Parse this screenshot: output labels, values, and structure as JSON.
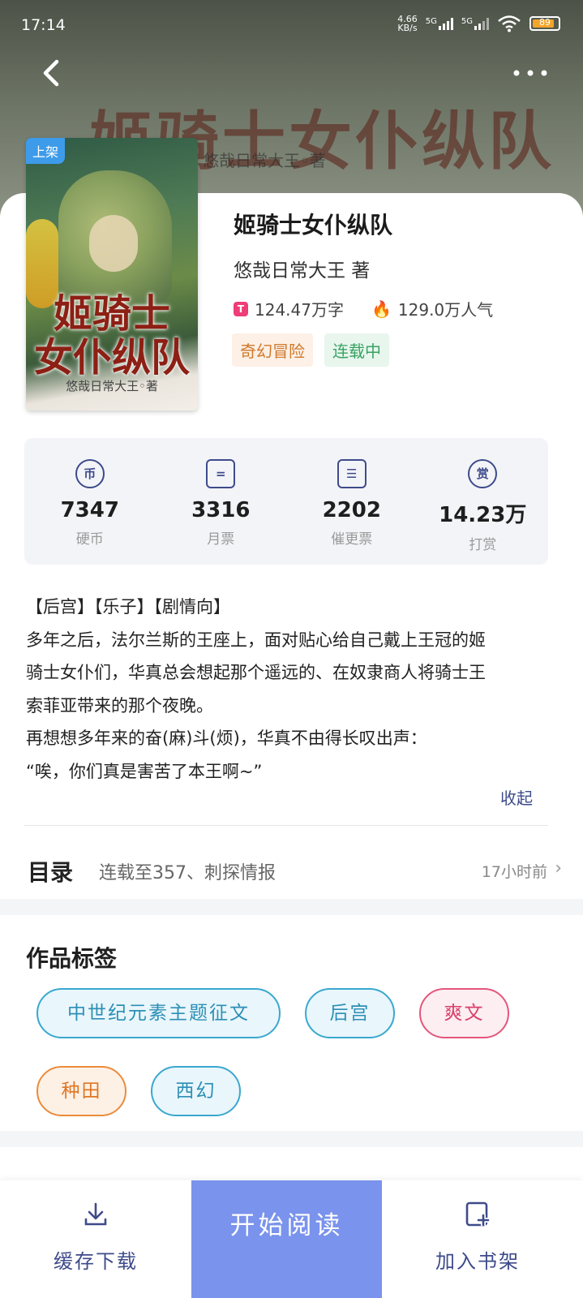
{
  "status_bar": {
    "time": "17:14",
    "net_speed_value": "4.66",
    "net_speed_unit": "KB/s",
    "signal1": "5G",
    "signal2": "5G",
    "battery": "89"
  },
  "hero": {
    "blurred_title": "姬骑士女仆纵队",
    "blurred_author": "悠哉日常大王◦著"
  },
  "book": {
    "cover_badge": "上架",
    "cover_title_line1": "姬骑士",
    "cover_title_line2": "女仆纵队",
    "cover_author": "悠哉日常大王◦著",
    "title": "姬骑士女仆纵队",
    "author": "悠哉日常大王 著",
    "word_icon": "T",
    "word_count": "124.47万字",
    "popularity": "129.0万人气",
    "genre": "奇幻冒险",
    "status": "连载中"
  },
  "stats": [
    {
      "icon": "coin-icon",
      "glyph": "币",
      "value": "7347",
      "label": "硬币"
    },
    {
      "icon": "ticket-icon",
      "glyph": "=",
      "value": "3316",
      "label": "月票"
    },
    {
      "icon": "urge-icon",
      "glyph": "☰",
      "value": "2202",
      "label": "催更票"
    },
    {
      "icon": "reward-icon",
      "glyph": "赏",
      "value": "14.23万",
      "label": "打赏"
    }
  ],
  "description": {
    "lines": [
      "【后宫】【乐子】【剧情向】",
      "多年之后，法尔兰斯的王座上，面对贴心给自己戴上王冠的姬",
      "骑士女仆们，华真总会想起那个遥远的、在奴隶商人将骑士王",
      "索菲亚带来的那个夜晚。",
      "再想想多年来的奋(麻)斗(烦)，华真不由得长叹出声：",
      "“唉，你们真是害苦了本王啊~”"
    ],
    "collapse_label": "收起"
  },
  "toc": {
    "label": "目录",
    "latest": "连载至357、刺探情报",
    "time": "17小时前"
  },
  "tags": {
    "title": "作品标签",
    "items": [
      {
        "label": "中世纪元素主题征文",
        "color": "blue"
      },
      {
        "label": "后宫",
        "color": "blue"
      },
      {
        "label": "爽文",
        "color": "pink"
      },
      {
        "label": "种田",
        "color": "orange"
      },
      {
        "label": "西幻",
        "color": "blue"
      }
    ]
  },
  "bottom_bar": {
    "download_label": "缓存下载",
    "read_label": "开始阅读",
    "shelf_label": "加入书架"
  }
}
